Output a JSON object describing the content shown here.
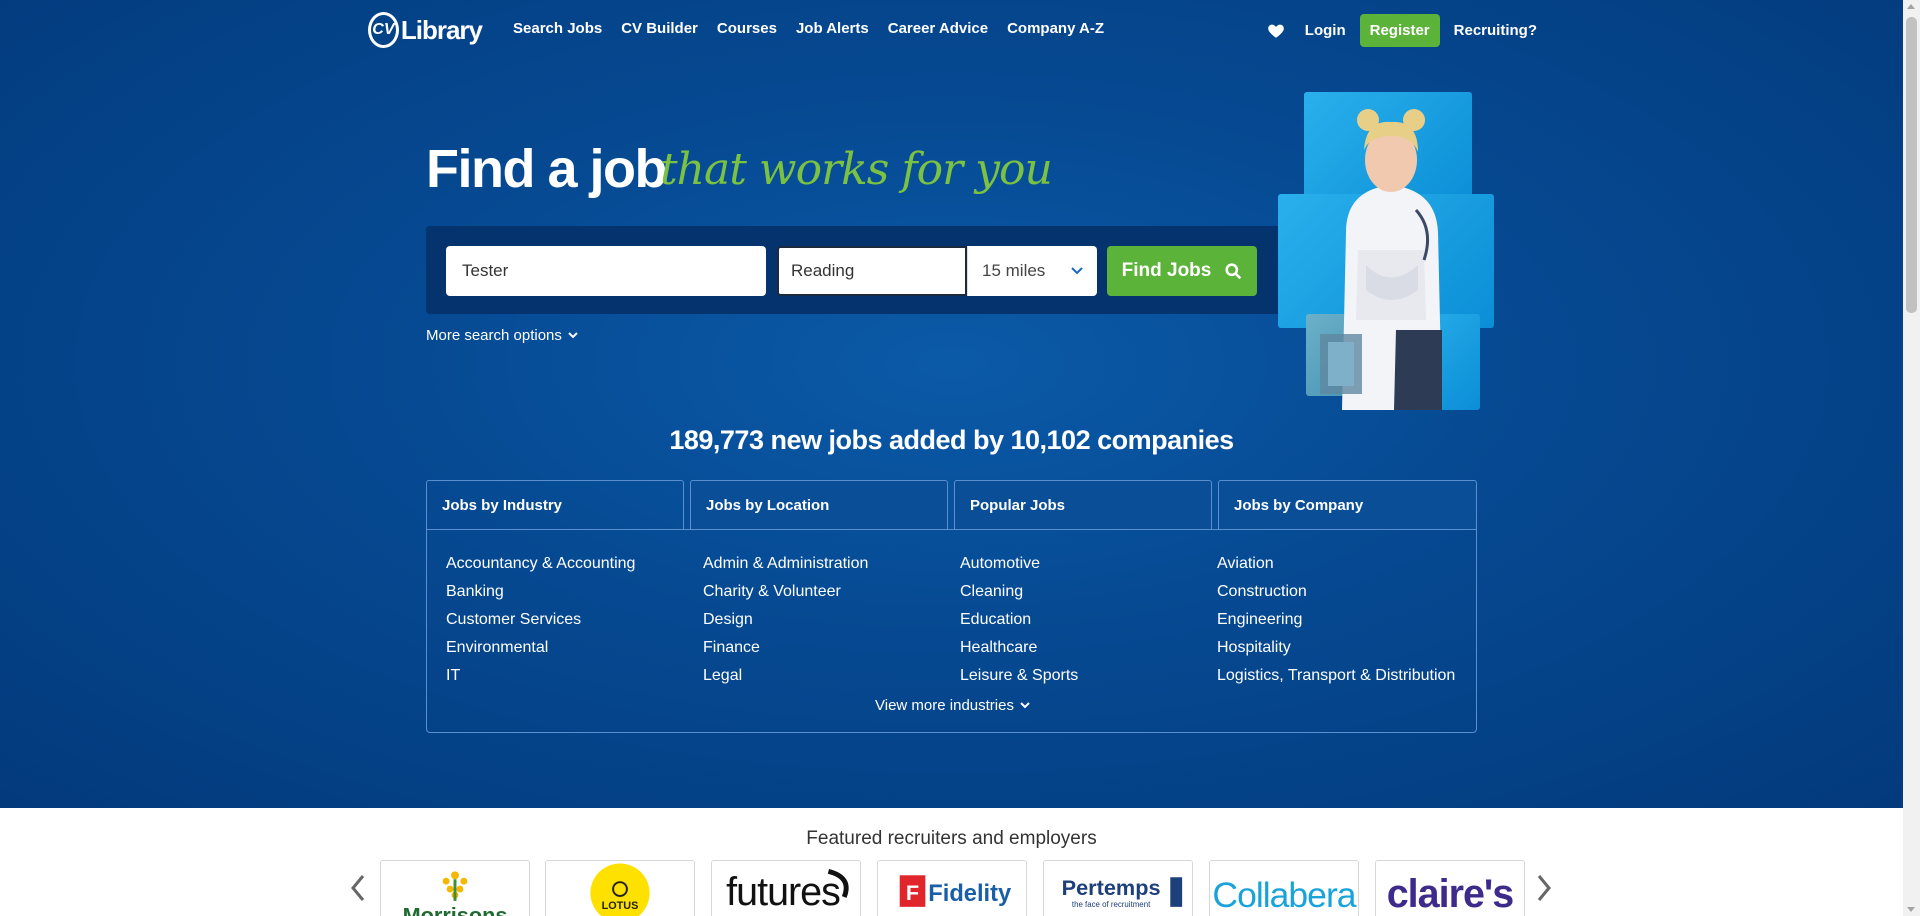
{
  "nav": {
    "logo": "CV-Library",
    "links": [
      "Search Jobs",
      "CV Builder",
      "Courses",
      "Job Alerts",
      "Career Advice",
      "Company A-Z"
    ],
    "login": "Login",
    "register": "Register",
    "recruiting": "Recruiting?"
  },
  "hero": {
    "heading_main": "Find a job",
    "heading_script": "that works for you"
  },
  "search": {
    "keywords_value": "Tester",
    "location_value": "Reading",
    "radius_value": "15 miles",
    "find_button": "Find Jobs",
    "more_options": "More search options"
  },
  "stats": "189,773 new jobs added by 10,102 companies",
  "tabs": {
    "labels": [
      "Jobs by Industry",
      "Jobs by Location",
      "Popular Jobs",
      "Jobs by Company"
    ],
    "active": "Jobs by Industry",
    "industries": [
      [
        "Accountancy & Accounting",
        "Banking",
        "Customer Services",
        "Environmental",
        "IT"
      ],
      [
        "Admin & Administration",
        "Charity & Volunteer",
        "Design",
        "Finance",
        "Legal"
      ],
      [
        "Automotive",
        "Cleaning",
        "Education",
        "Healthcare",
        "Leisure & Sports"
      ],
      [
        "Aviation",
        "Construction",
        "Engineering",
        "Hospitality",
        "Logistics, Transport & Distribution"
      ]
    ],
    "view_more": "View more industries"
  },
  "featured": {
    "title": "Featured recruiters and employers",
    "logos": [
      "Morrisons",
      "LOTUS",
      "futures",
      "Fidelity",
      "Pertemps",
      "Collabera",
      "claire's"
    ],
    "pertemps_tagline": "the face of recruitment"
  },
  "colors": {
    "hero_blue": "#064a93",
    "accent_green": "#5cb33a",
    "script_green": "#7cc242"
  }
}
